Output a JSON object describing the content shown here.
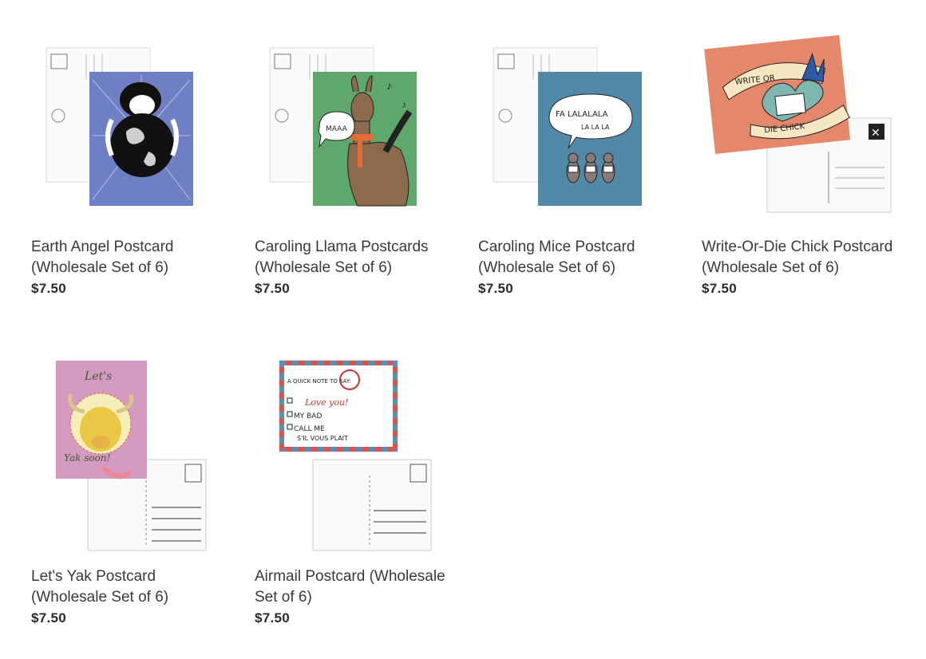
{
  "products": [
    {
      "title": "Earth Angel Postcard (Wholesale Set of 6)",
      "price": "$7.50",
      "image_alt": "earth-angel-postcard-image"
    },
    {
      "title": "Caroling Llama Postcards (Wholesale Set of 6)",
      "price": "$7.50",
      "image_alt": "caroling-llama-postcard-image"
    },
    {
      "title": "Caroling Mice Postcard (Wholesale Set of 6)",
      "price": "$7.50",
      "image_alt": "caroling-mice-postcard-image"
    },
    {
      "title": "Write-Or-Die Chick Postcard (Wholesale Set of 6)",
      "price": "$7.50",
      "image_alt": "write-or-die-chick-postcard-image"
    },
    {
      "title": "Let's Yak Postcard (Wholesale Set of 6)",
      "price": "$7.50",
      "image_alt": "lets-yak-postcard-image"
    },
    {
      "title": "Airmail Postcard (Wholesale Set of 6)",
      "price": "$7.50",
      "image_alt": "airmail-postcard-image"
    }
  ],
  "art_text": {
    "llama_bubble": "MAAA",
    "mice_bubble_1": "FA LALALALA",
    "mice_bubble_2": "LA LA LA",
    "chick_banner_top": "WRITE OR",
    "chick_banner_bottom": "DIE CHICK",
    "yak_top": "Let's",
    "yak_bottom": "Yak soon!",
    "airmail_heading": "A QUICK NOTE TO SAY:",
    "airmail_opt1": "Love you!",
    "airmail_opt2": "MY BAD",
    "airmail_opt3": "CALL ME",
    "airmail_opt4": "S'IL VOUS PLAIT",
    "stamp_label": "STAMP"
  },
  "colors": {
    "earth_angel_bg": "#6f7fc4",
    "llama_bg": "#5fa86d",
    "mice_bg": "#5189a8",
    "chick_bg": "#e5876b",
    "yak_bg": "#d59ac0",
    "airmail_red": "#d9534f",
    "airmail_blue": "#5b8fb9"
  }
}
